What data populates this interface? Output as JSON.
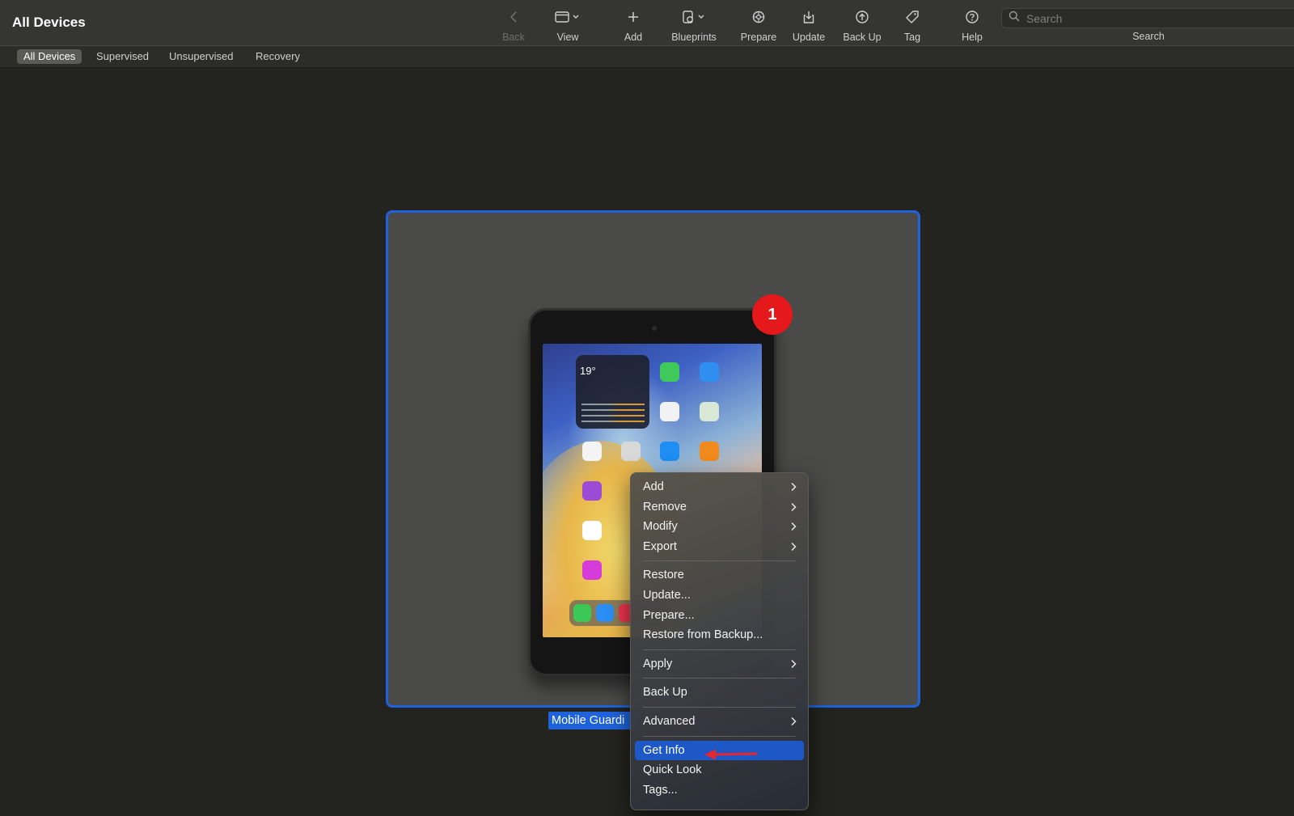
{
  "window": {
    "title": "All Devices"
  },
  "toolbar": {
    "buttons": [
      {
        "label": "Back",
        "icon": "chevron-left-icon",
        "enabled": false
      },
      {
        "label": "View",
        "icon": "view-menu-icon",
        "enabled": true
      },
      {
        "label": "Add",
        "icon": "plus-icon",
        "enabled": true
      },
      {
        "label": "Blueprints",
        "icon": "blueprints-icon",
        "enabled": true
      },
      {
        "label": "Prepare",
        "icon": "prepare-gear-icon",
        "enabled": true
      },
      {
        "label": "Update",
        "icon": "update-download-icon",
        "enabled": true
      },
      {
        "label": "Back Up",
        "icon": "backup-upload-icon",
        "enabled": true
      },
      {
        "label": "Tag",
        "icon": "tag-icon",
        "enabled": true
      },
      {
        "label": "Help",
        "icon": "help-icon",
        "enabled": true
      }
    ],
    "search": {
      "placeholder": "Search",
      "label": "Search"
    }
  },
  "filters": {
    "items": [
      "All Devices",
      "Supervised",
      "Unsupervised",
      "Recovery"
    ],
    "selected": "All Devices"
  },
  "device": {
    "name": "Mobile Guardi",
    "annotation_badge": "1",
    "screen": {
      "weather_temp": "19°"
    }
  },
  "context_menu": {
    "items": [
      {
        "label": "Add",
        "submenu": true
      },
      {
        "label": "Remove",
        "submenu": true
      },
      {
        "label": "Modify",
        "submenu": true
      },
      {
        "label": "Export",
        "submenu": true
      },
      {
        "label": "Restore",
        "submenu": false
      },
      {
        "label": "Update...",
        "submenu": false
      },
      {
        "label": "Prepare...",
        "submenu": false
      },
      {
        "label": "Restore from Backup...",
        "submenu": false
      },
      {
        "label": "Apply",
        "submenu": true
      },
      {
        "label": "Back Up",
        "submenu": false
      },
      {
        "label": "Advanced",
        "submenu": true
      },
      {
        "label": "Get Info",
        "submenu": false,
        "highlighted": true
      },
      {
        "label": "Quick Look",
        "submenu": false
      },
      {
        "label": "Tags...",
        "submenu": false
      }
    ]
  },
  "colors": {
    "selection_blue": "#1e63dc",
    "menu_highlight": "#1e57c6",
    "badge_red": "#e5191b",
    "annotation_arrow": "#e8262b",
    "window_bg": "#23241f"
  }
}
